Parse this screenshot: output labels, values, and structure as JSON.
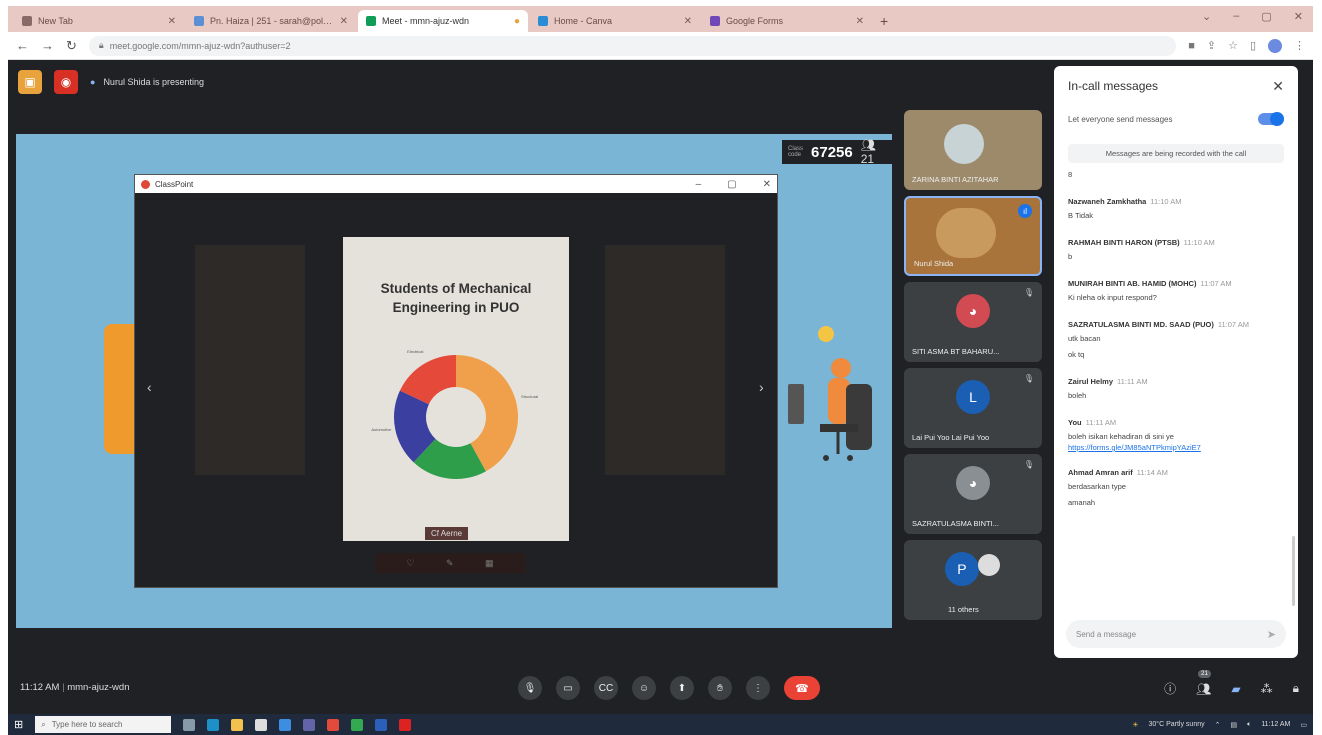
{
  "browser": {
    "tabs": [
      {
        "label": "New Tab",
        "color": "#8a6a66"
      },
      {
        "label": "Pn. Haiza | 251 - sarah@polisas...",
        "color": "#5a8fd6"
      },
      {
        "label": "Meet - mmn-ajuz-wdn",
        "color": "#0f9d58",
        "active": true
      },
      {
        "label": "Home - Canva",
        "color": "#2b8cd6"
      },
      {
        "label": "Google Forms",
        "color": "#7248b9"
      }
    ],
    "new_tab": "+",
    "url": "meet.google.com/mmn-ajuz-wdn?authuser=2"
  },
  "meet": {
    "presenting_text": "Nurul Shida is presenting",
    "meeting_code": "67256",
    "code_caption": "Class code",
    "participant_count": "21",
    "classpoint_title": "ClassPoint",
    "slide": {
      "title_line1": "Students of Mechanical",
      "title_line2": "Engineering in PUO",
      "caption": "Cf Aerne"
    },
    "time": "11:12 AM",
    "meeting_id": "mmn-ajuz-wdn",
    "people_badge": "21"
  },
  "chart_data": {
    "type": "pie",
    "categories": [
      "Structural",
      "Mechanical",
      "Automotive",
      "Electrical"
    ],
    "values": [
      42,
      20,
      20,
      18
    ],
    "colors": [
      "#f0a04b",
      "#2e9e4a",
      "#3b3fa0",
      "#e5493a"
    ]
  },
  "participants": [
    {
      "name": "ZARINA BINTI AZITAHAR",
      "type": "video",
      "bg": "#9c8a6a"
    },
    {
      "name": "Nurul Shida",
      "type": "video",
      "bg": "#a8743c"
    },
    {
      "name": "SITI ASMA BT BAHARU...",
      "type": "photo",
      "bg": "#3c4043"
    },
    {
      "name": "Lai Pui Yoo Lai Pui Yoo",
      "type": "initial",
      "initial": "L",
      "bg": "#3c4043"
    },
    {
      "name": "SAZRATULASMA BINTI...",
      "type": "photo",
      "bg": "#3c4043"
    },
    {
      "name": "11 others",
      "type": "initial",
      "initial": "P",
      "bg": "#3c4043"
    }
  ],
  "chat": {
    "title": "In-call messages",
    "toggle_label": "Let everyone send messages",
    "record_note": "Messages are being recorded with the call",
    "stray": "8",
    "messages": [
      {
        "sender": "Nazwaneh Zamkhatha",
        "time": "11:10 AM",
        "text": "B Tidak"
      },
      {
        "sender": "RAHMAH BINTI HARON (PTSB)",
        "time": "11:10 AM",
        "text": "b"
      },
      {
        "sender": "MUNIRAH BINTI AB. HAMID (MOHC)",
        "time": "11:07 AM",
        "text": "Ki nleha ok input respond?"
      },
      {
        "sender": "SAZRATULASMA BINTI MD. SAAD (PUO)",
        "time": "11:07 AM",
        "text": "utk bacan",
        "text2": "ok tq"
      },
      {
        "sender": "Zairul Helmy",
        "time": "11:11 AM",
        "text": "boleh"
      },
      {
        "sender": "You",
        "time": "11:11 AM",
        "text": "boleh isikan kehadiran di sini ye",
        "link": "https://forms.gle/JM85aNTPkmipYAziE7"
      },
      {
        "sender": "Ahmad Amran arif",
        "time": "11:14 AM",
        "text": "berdasarkan type",
        "text2": "amanah"
      }
    ],
    "compose_placeholder": "Send a message"
  },
  "taskbar": {
    "search_placeholder": "Type here to search",
    "weather": "30°C Partly sunny",
    "clock": "11:12 AM"
  }
}
